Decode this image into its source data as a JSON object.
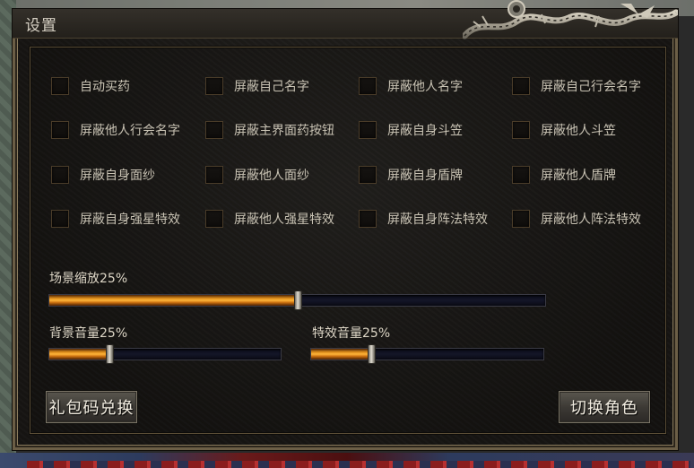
{
  "window": {
    "title": "设置"
  },
  "checkboxes": [
    {
      "label": "自动买药",
      "checked": false
    },
    {
      "label": "屏蔽自己名字",
      "checked": false
    },
    {
      "label": "屏蔽他人名字",
      "checked": false
    },
    {
      "label": "屏蔽自己行会名字",
      "checked": false
    },
    {
      "label": "屏蔽他人行会名字",
      "checked": false
    },
    {
      "label": "屏蔽主界面药按钮",
      "checked": false
    },
    {
      "label": "屏蔽自身斗笠",
      "checked": false
    },
    {
      "label": "屏蔽他人斗笠",
      "checked": false
    },
    {
      "label": "屏蔽自身面纱",
      "checked": false
    },
    {
      "label": "屏蔽他人面纱",
      "checked": false
    },
    {
      "label": "屏蔽自身盾牌",
      "checked": false
    },
    {
      "label": "屏蔽他人盾牌",
      "checked": false
    },
    {
      "label": "屏蔽自身强星特效",
      "checked": false
    },
    {
      "label": "屏蔽他人强星特效",
      "checked": false
    },
    {
      "label": "屏蔽自身阵法特效",
      "checked": false
    },
    {
      "label": "屏蔽他人阵法特效",
      "checked": false
    }
  ],
  "sliders": {
    "scene_zoom": {
      "label": "场景缩放25%",
      "fill_fraction": 0.5
    },
    "bg_volume": {
      "label": "背景音量25%",
      "fill_fraction": 0.26
    },
    "fx_volume": {
      "label": "特效音量25%",
      "fill_fraction": 0.26
    }
  },
  "buttons": {
    "gift_code": "礼包码兑换",
    "switch_role": "切换角色"
  },
  "colors": {
    "accent_fill": "#ffb53a",
    "panel_border": "#8a7b5d",
    "text": "#c9c3b4"
  }
}
